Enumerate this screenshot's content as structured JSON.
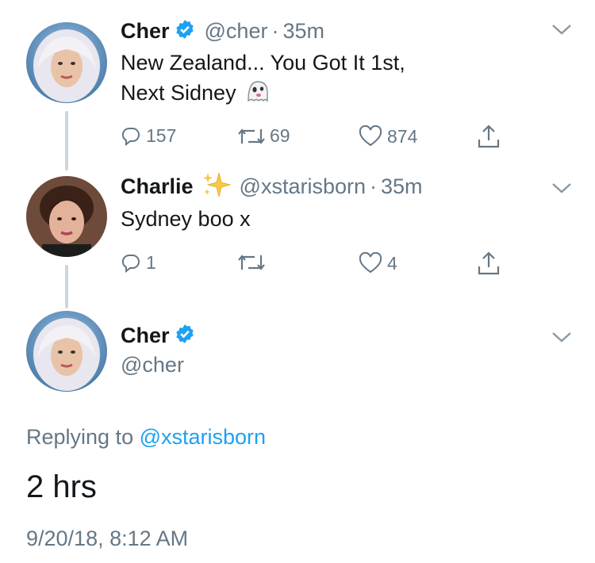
{
  "tweets": [
    {
      "name": "Cher",
      "verified": true,
      "handle": "@cher",
      "dot": "·",
      "time": "35m",
      "lines": [
        "New Zealand... You  Got It 1st,",
        "Next Sidney"
      ],
      "emoji": "ghost-emoji",
      "replies": "157",
      "retweets": "69",
      "likes": "874"
    },
    {
      "name": "Charlie",
      "name_emoji": "sparkles-emoji",
      "handle": "@xstarisborn",
      "dot": "·",
      "time": "35m",
      "lines": [
        "Sydney boo x"
      ],
      "replies": "1",
      "retweets": "",
      "likes": "4"
    }
  ],
  "main_tweet": {
    "name": "Cher",
    "verified": true,
    "handle": "@cher",
    "replying_prefix": "Replying to",
    "replying_handle": "@xstarisborn",
    "text": "2 hrs",
    "timestamp": "9/20/18, 8:12 AM"
  },
  "colors": {
    "link": "#1da1f2",
    "muted": "#657786",
    "verified": "#1da1f2",
    "thread_line": "#ccd6dd"
  }
}
